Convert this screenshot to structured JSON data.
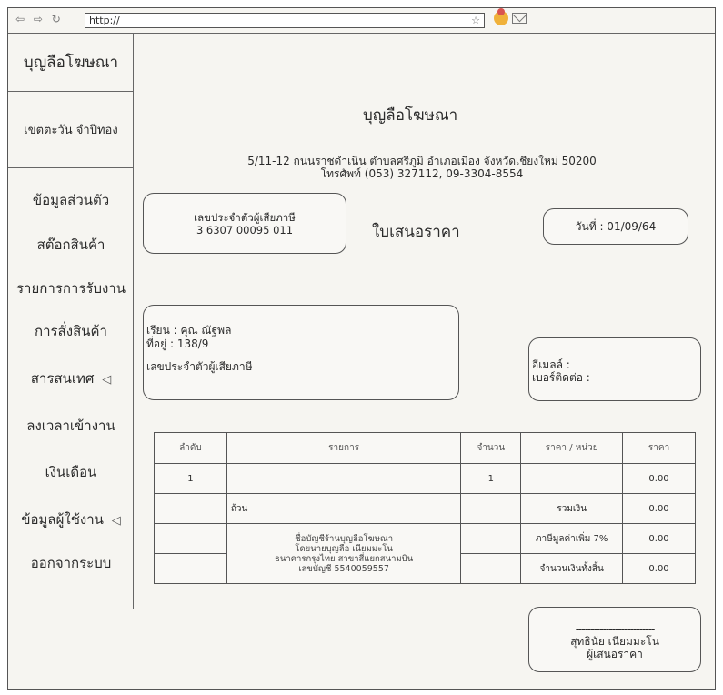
{
  "browser": {
    "nav_glyphs": [
      "⇦",
      "⇨",
      "↻"
    ],
    "url": "http://",
    "bookmark_icon": "☆"
  },
  "sidebar": {
    "brand": "บุญลือโฆษณา",
    "user": "เขตตะวัน จำปีทอง",
    "items": [
      {
        "label": "ข้อมูลส่วนตัว",
        "arrow": ""
      },
      {
        "label": "สต๊อกสินค้า",
        "arrow": ""
      },
      {
        "label": "รายการการรับงาน",
        "arrow": ""
      },
      {
        "label": "การสั่งสินค้า",
        "arrow": ""
      },
      {
        "label": "สารสนเทศ",
        "arrow": "◁"
      },
      {
        "label": "ลงเวลาเข้างาน",
        "arrow": ""
      },
      {
        "label": "เงินเดือน",
        "arrow": ""
      },
      {
        "label": "ข้อมูลผู้ใช้งาน",
        "arrow": "◁"
      },
      {
        "label": "ออกจากระบบ",
        "arrow": ""
      }
    ]
  },
  "document": {
    "company": "บุญลือโฆษณา",
    "address_line1": "5/11-12 ถนนราชดำเนิน ตำบลศรีภูมิ อำเภอเมือง จังหวัดเชียงใหม่ 50200",
    "address_line2": "โทรศัพท์ (053) 327112, 09-3304-8554",
    "tax_label": "เลขประจำตัวผู้เสียภาษี",
    "tax_id": "3 6307 00095 011",
    "title": "ใบเสนอราคา",
    "date": "วันที่ : 01/09/64",
    "customer": {
      "dear": "เรียน : คุณ ณัฐพล",
      "address": "ที่อยู่ : 138/9",
      "tax": "เลขประจำตัวผู้เสียภาษี"
    },
    "contact": {
      "email": "อีเมลล์ :",
      "phone": "เบอร์ติดต่อ :"
    },
    "table": {
      "headers": [
        "ลำดับ",
        "รายการ",
        "จำนวน",
        "ราคา / หน่วย",
        "ราคา"
      ],
      "row": {
        "no": "1",
        "item": "",
        "qty": "1",
        "unit_price": "",
        "price": "0.00"
      },
      "amount_words": "ถ้วน",
      "bank_note": [
        "ชื่อบัญชีร้านบุญลือโฆษณา",
        "โดยนายบุญลือ เนียมมะโน",
        "ธนาคารกรุงไทย สาขาสี่แยกสนามบิน",
        "เลขบัญชี 5540059557"
      ],
      "subtotal_label": "รวมเงิน",
      "subtotal": "0.00",
      "vat_label": "ภาษีมูลค่าเพิ่ม 7%",
      "vat": "0.00",
      "total_label": "จำนวนเงินทั้งสิ้น",
      "total": "0.00"
    },
    "signature": {
      "line": "--------------------------",
      "name": "สุทธินัย เนียมมะโน",
      "role": "ผู้เสนอราคา"
    }
  }
}
